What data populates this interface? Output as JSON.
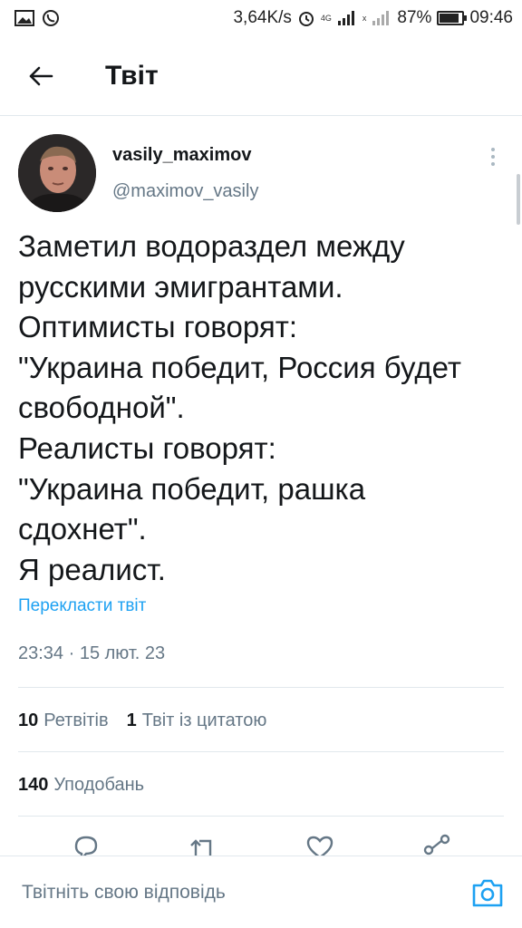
{
  "status_bar": {
    "speed": "3,64K/s",
    "network": "4G",
    "sim2": "x",
    "battery": "87%",
    "battery_level": 0.87,
    "time": "09:46"
  },
  "header": {
    "title": "Твіт"
  },
  "tweet": {
    "author_name": "vasily_maximov",
    "author_handle": "@maximov_vasily",
    "text_lines": [
      "Заметил водораздел между",
      "русскими эмигрантами.",
      "Оптимисты говорят:",
      "\"Украина победит, Россия будет",
      "свободной\".",
      "Реалисты говорят:",
      "\"Украина победит, рашка",
      "сдохнет\".",
      "Я реалист."
    ],
    "translate_label": "Перекласти твіт",
    "timestamp": "23:34 · 15 лют. 23"
  },
  "stats": {
    "retweets_count": "10",
    "retweets_label": "Ретвітів",
    "quotes_count": "1",
    "quotes_label": "Твіт із цитатою",
    "likes_count": "140",
    "likes_label": "Уподобань"
  },
  "reply_bar": {
    "placeholder": "Твітніть свою відповідь"
  },
  "colors": {
    "accent": "#1da1f2",
    "text": "#14171a",
    "secondary_text": "#657786",
    "divider": "#e1e8ed"
  },
  "icons": [
    "back-arrow-icon",
    "more-icon",
    "reply-icon",
    "retweet-icon",
    "like-icon",
    "share-icon",
    "camera-icon"
  ]
}
